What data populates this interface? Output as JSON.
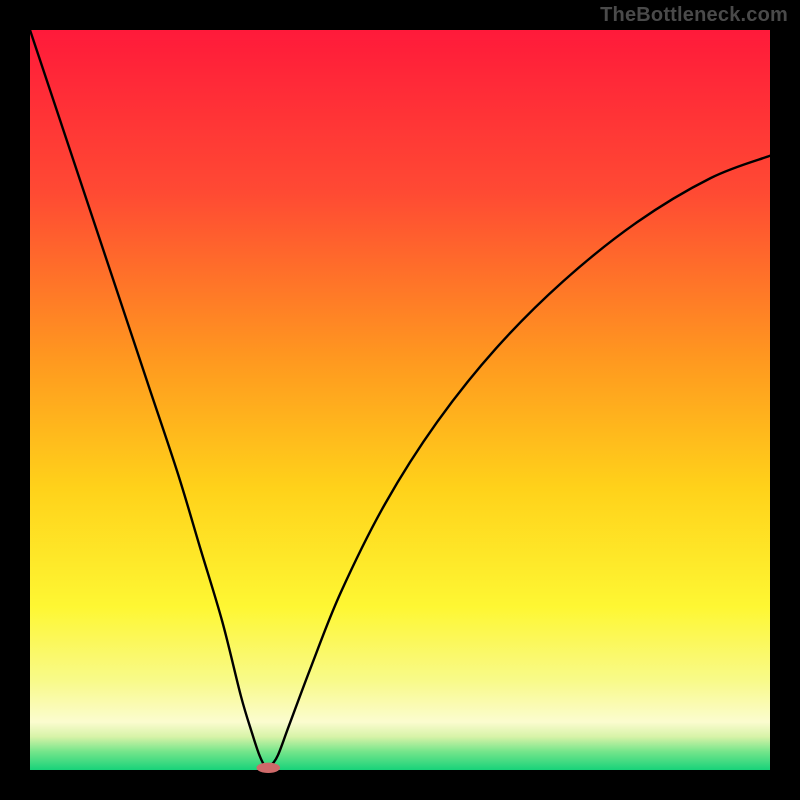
{
  "watermark": {
    "text": "TheBottleneck.com"
  },
  "chart_data": {
    "type": "line",
    "title": "",
    "xlabel": "",
    "ylabel": "",
    "xlim": [
      0,
      100
    ],
    "ylim": [
      0,
      100
    ],
    "grid": false,
    "background_gradient": {
      "stops": [
        {
          "offset": 0.0,
          "color": "#ff1a3a"
        },
        {
          "offset": 0.22,
          "color": "#ff4a33"
        },
        {
          "offset": 0.45,
          "color": "#ff9a1f"
        },
        {
          "offset": 0.62,
          "color": "#ffd21a"
        },
        {
          "offset": 0.78,
          "color": "#fef733"
        },
        {
          "offset": 0.88,
          "color": "#f8fa8a"
        },
        {
          "offset": 0.935,
          "color": "#fbfccf"
        },
        {
          "offset": 0.955,
          "color": "#d7f3a8"
        },
        {
          "offset": 0.975,
          "color": "#75e58b"
        },
        {
          "offset": 1.0,
          "color": "#18d37a"
        }
      ]
    },
    "series": [
      {
        "name": "bottleneck-curve",
        "color": "#000000",
        "x": [
          0,
          4,
          8,
          12,
          16,
          20,
          23,
          26,
          28.5,
          30,
          31,
          31.8,
          32.5,
          33.5,
          35,
          38,
          42,
          48,
          55,
          63,
          72,
          82,
          92,
          100
        ],
        "y": [
          100,
          88,
          76,
          64,
          52,
          40,
          30,
          20,
          10,
          5,
          2,
          0.5,
          0.6,
          2,
          6,
          14,
          24,
          36,
          47,
          57,
          66,
          74,
          80,
          83
        ]
      }
    ],
    "marker": {
      "name": "min-point",
      "x": 32.2,
      "y": 0.3,
      "color": "#cf6a6a",
      "rx": 1.6,
      "ry": 0.7
    }
  }
}
